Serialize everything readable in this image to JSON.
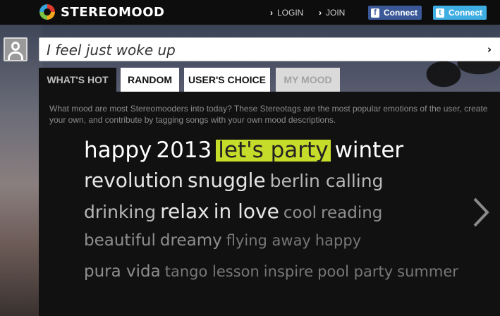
{
  "topbar": {
    "brand": "STEREOMOOD",
    "login": "LOGIN",
    "join": "JOIN",
    "facebook_connect": "Connect",
    "twitter_connect": "Connect"
  },
  "mood_input": {
    "value": "I feel just woke up"
  },
  "tabs": [
    {
      "label": "WHAT'S HOT",
      "state": "active"
    },
    {
      "label": "RANDOM",
      "state": "normal"
    },
    {
      "label": "USER'S CHOICE",
      "state": "normal"
    },
    {
      "label": "MY MOOD",
      "state": "disabled"
    }
  ],
  "description": "What mood are most Stereomooders into today? These Stereotags are the most popular emotions of the user, create your own, and contribute by tagging songs with your own mood descriptions.",
  "tag_cloud": [
    [
      {
        "text": "happy",
        "size": 1
      },
      {
        "text": "2013",
        "size": 1
      },
      {
        "text": "let's party",
        "size": 1,
        "highlighted": true
      },
      {
        "text": "winter",
        "size": 1
      }
    ],
    [
      {
        "text": "revolution",
        "size": 2
      },
      {
        "text": "snuggle",
        "size": 2
      },
      {
        "text": "berlin calling",
        "size": 3
      }
    ],
    [
      {
        "text": "drinking",
        "size": 3
      },
      {
        "text": "relax",
        "size": 2
      },
      {
        "text": "in love",
        "size": 2
      },
      {
        "text": "cool",
        "size": 4
      },
      {
        "text": "reading",
        "size": 4
      }
    ],
    [
      {
        "text": "beautiful",
        "size": 4
      },
      {
        "text": "dreamy",
        "size": 4
      },
      {
        "text": "flying away",
        "size": 5
      },
      {
        "text": "happy",
        "size": 5
      }
    ],
    [
      {
        "text": "pura vida",
        "size": 4
      },
      {
        "text": "tango lesson",
        "size": 5
      },
      {
        "text": "inspire",
        "size": 5
      },
      {
        "text": "pool party",
        "size": 5
      },
      {
        "text": "summer",
        "size": 5
      }
    ]
  ],
  "colors": {
    "highlight": "#c6dc2a",
    "facebook": "#3b5998",
    "twitter": "#3faee3",
    "panel": "#111111"
  },
  "icons": {
    "logo": "stereomood-logo-icon",
    "avatar": "user-avatar-icon",
    "next": "chevron-right-icon"
  }
}
